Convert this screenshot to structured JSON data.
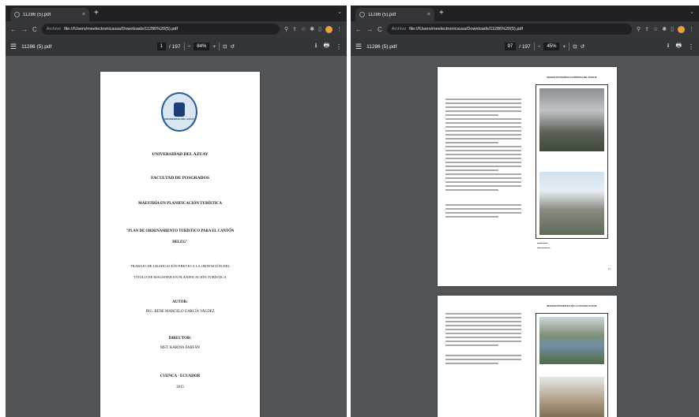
{
  "left": {
    "tab_title": "11286 (5).pdf",
    "tab_close": "×",
    "new_tab": "+",
    "tab_menu": "⌄",
    "nav": {
      "back": "←",
      "forward": "→",
      "reload": "C"
    },
    "url": {
      "scheme": "Archivo",
      "path": "file:///Users/meelectronicsusa/Downloads/11286%20(5).pdf"
    },
    "pdf": {
      "menu_icon": "☰",
      "file_name": "11286 (5).pdf",
      "page_current": "1",
      "page_total": "/ 197",
      "zoom_minus": "−",
      "zoom_value": "84%",
      "zoom_plus": "+",
      "download_icon": "⭳",
      "print_icon": "🖶",
      "more_icon": "⋮"
    },
    "cover": {
      "seal_text": "UNIVERSIDAD DEL AZUAY",
      "university": "UNIVERSIDAD DEL AZUAY",
      "faculty": "FACULTAD DE POSGRADOS",
      "master": "MAESTRÍA EN PLANIFICACIÓN TURÍSTICA",
      "title_line1": "\"PLAN DE ORDENAMIENTO TURÍSTICO PARA EL CANTÓN",
      "title_line2": "DELEG\"",
      "work_line1": "TRABAJO DE GRADUACIÓN PREVIO A LA OBTENCIÓN DEL",
      "work_line2": "TÍTULO DE MAGISTER EN PLANIFICACIÓN TURÍSTICA",
      "author_label": "AUTOR:",
      "author_name": "ING. RENE MARCELO GARCÍA VALDEZ",
      "director_label": "DIRECTOR:",
      "director_name": "MST. KARINA FARFÁN",
      "place": "CUENCA - ECUADOR",
      "year": "2015"
    }
  },
  "right": {
    "tab_title": "11286 (5).pdf",
    "tab_close": "×",
    "new_tab": "+",
    "tab_menu": "⌄",
    "nav": {
      "back": "←",
      "forward": "→",
      "reload": "C"
    },
    "url": {
      "scheme": "Archivo",
      "path": "file:///Users/meelectronicsusa/Downloads/11286%20(5).pdf"
    },
    "pdf": {
      "menu_icon": "☰",
      "file_name": "11286 (5).pdf",
      "page_current": "97",
      "page_total": "/ 197",
      "zoom_minus": "−",
      "zoom_value": "45%",
      "zoom_plus": "+",
      "download_icon": "⭳",
      "print_icon": "🖶",
      "more_icon": "⋮"
    },
    "page1": {
      "fig_title": "IMAGEN FOTOGRÁFICA AUTÉNTICA DEL PAISAJE",
      "page_number": "94"
    },
    "page2": {
      "fig_title": "IMAGEN FOTOGRÁFICA DE LA CASCADA PLAYITA",
      "page_number": ""
    }
  },
  "colors": {
    "window_bg": "#525659",
    "toolbar": "#323639",
    "tabstrip": "#202124"
  }
}
